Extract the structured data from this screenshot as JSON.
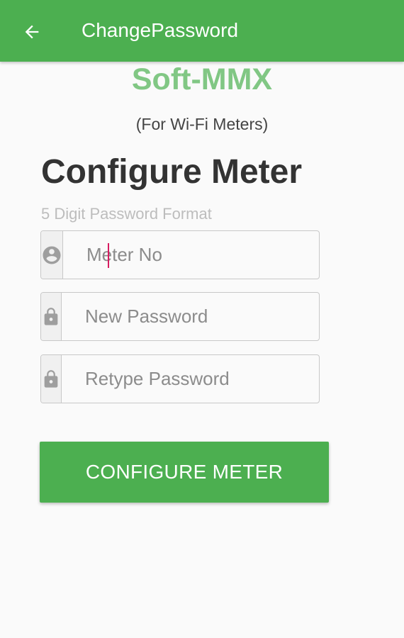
{
  "app_bar": {
    "title": "ChangePassword",
    "back_icon": "arrow-left-icon",
    "background_color": "#4caf50"
  },
  "brand": {
    "name": "Soft-MMX",
    "subtitle": "(For Wi-Fi Meters)",
    "color": "#81c784"
  },
  "form": {
    "heading": "Configure Meter",
    "hint": "5 Digit Password Format",
    "fields": [
      {
        "icon": "account-circle-icon",
        "placeholder": "Meter No",
        "value": "",
        "focused": true
      },
      {
        "icon": "lock-icon",
        "placeholder": "New Password",
        "value": ""
      },
      {
        "icon": "lock-icon",
        "placeholder": "Retype Password",
        "value": ""
      }
    ],
    "submit_label": "CONFIGURE METER"
  }
}
